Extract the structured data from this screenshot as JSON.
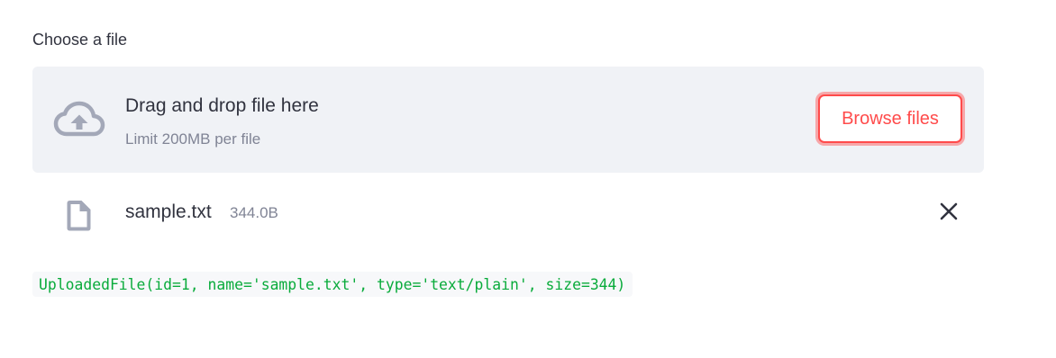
{
  "uploader": {
    "label": "Choose a file",
    "dropzone": {
      "title": "Drag and drop file here",
      "limit": "Limit 200MB per file",
      "icon": "cloud-upload-icon"
    },
    "browse_button_label": "Browse files"
  },
  "uploaded_file": {
    "icon": "file-icon",
    "name": "sample.txt",
    "size": "344.0B",
    "delete_icon": "close-icon"
  },
  "output": {
    "text": "UploadedFile(id=1, name='sample.txt', type='text/plain', size=344)"
  },
  "colors": {
    "primary": "#ff4b4b",
    "dropzone_bg": "#f0f2f6",
    "text": "#31333f",
    "muted_text": "#808495",
    "icon": "#a3a8b8",
    "code_green": "#09ab3b"
  }
}
